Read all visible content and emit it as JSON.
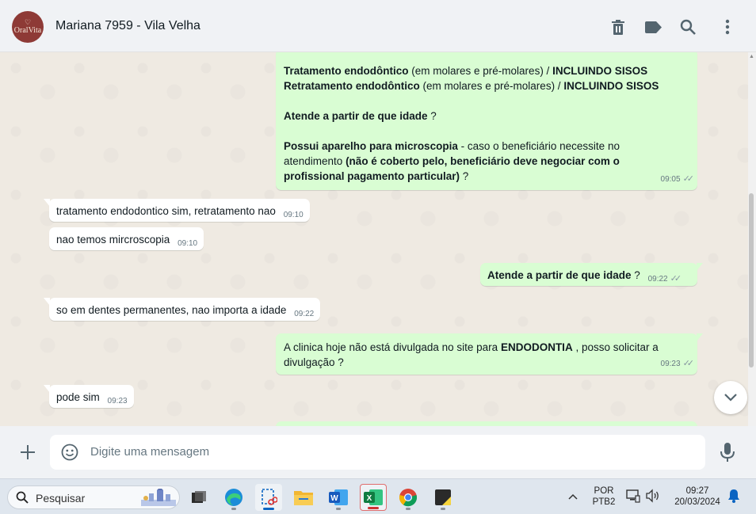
{
  "header": {
    "avatar_text": "OralVita",
    "contact_name": "Mariana 7959 - Vila Velha",
    "icons": [
      "trash-icon",
      "label-icon",
      "search-icon",
      "more-vertical-icon"
    ]
  },
  "messages": {
    "m1": {
      "line1_bold_a": "Tratamento endodôntico",
      "line1_plain": " (em molares e pré-molares) / ",
      "line1_bold_b": "INCLUINDO SISOS",
      "line2_bold_a": "Retratamento endodôntico",
      "line2_plain": " (em molares e pré-molares) / ",
      "line2_bold_b": "INCLUINDO SISOS",
      "line3_bold": "Atende a partir de que idade",
      "line3_plain": "  ?",
      "line4_bold": "Possui aparelho para microscopia",
      "line4_plain": " - caso o beneficiário necessite no atendimento ",
      "line4_bold2": "(não é coberto pelo, beneficiário deve negociar com o profissional pagamento particular)",
      "line4_end": "  ?",
      "time": "09:05"
    },
    "m2": {
      "text": "tratamento endodontico sim, retratamento nao",
      "time": "09:10"
    },
    "m3": {
      "text": "nao temos mircroscopia",
      "time": "09:10"
    },
    "m4": {
      "bold": "Atende a partir de que idade",
      "plain": "  ?",
      "time": "09:22"
    },
    "m5": {
      "text": "so em dentes permanentes, nao importa a idade",
      "time": "09:22"
    },
    "m6": {
      "plain_a": "A clinica hoje não está divulgada no site para ",
      "bold": "ENDODONTIA",
      "plain_b": " , posso solicitar a divulgação ?",
      "time": "09:23"
    },
    "m7": {
      "text": "pode sim",
      "time": "09:23"
    }
  },
  "composer": {
    "placeholder": "Digite uma mensagem"
  },
  "taskbar": {
    "search_label": "Pesquisar",
    "apps": [
      "task-view",
      "edge",
      "snipping-tool",
      "file-explorer",
      "word",
      "excel",
      "chrome",
      "sticky-notes"
    ],
    "lang_line1": "POR",
    "lang_line2": "PTB2",
    "time": "09:27",
    "date": "20/03/2024"
  },
  "colors": {
    "outgoing_bubble": "#d9fdd3",
    "incoming_bubble": "#ffffff",
    "chat_background": "#efeae2",
    "header_background": "#f0f2f5",
    "avatar_background": "#8e3a36"
  }
}
